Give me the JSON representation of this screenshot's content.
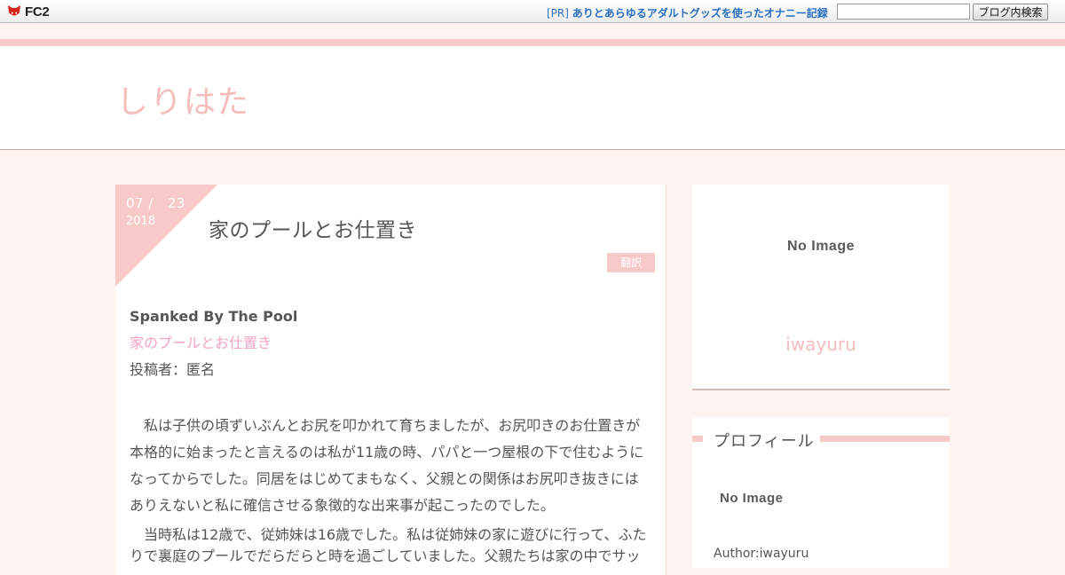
{
  "fc2bar": {
    "logo_text": "FC2",
    "pr_tag": "[PR]",
    "pr_text": "ありとあらゆるアダルトグッズを使ったオナニー記録",
    "search_value": "",
    "search_button": "ブログ内検索"
  },
  "header": {
    "blog_title": "しりはた"
  },
  "article": {
    "date_month_day": "07 /   23",
    "date_year": "2018",
    "title": "家のプールとお仕置き",
    "translate_button": "翻訳",
    "en_title": "Spanked By The Pool",
    "jp_title": "家のプールとお仕置き",
    "poster": "投稿者：匿名",
    "paragraph1": "私は子供の頃ずいぶんとお尻を叩かれて育ちましたが、お尻叩きのお仕置きが本格的に始まったと言えるのは私が11歳の時、パパと一つ屋根の下で住むようになってからでした。同居をはじめてまもなく、父親との関係はお尻叩き抜きにはありえないと私に確信させる象徴的な出来事が起こったのでした。",
    "paragraph2": "当時私は12歳で、従姉妹は16歳でした。私は従姉妹の家に遊びに行って、ふたりで裏庭のプールでだらだらと時を過ごしていました。父親たちは家の中でサッ"
  },
  "sidebar": {
    "no_image_big": "No Image",
    "name": "iwayuru",
    "profile_title": "プロフィール",
    "no_image_small": "No Image",
    "author": "Author:iwayuru"
  },
  "colors": {
    "accent_pink": "#f8c9c9",
    "link_blue": "#2a6fc2",
    "text": "#555555"
  }
}
